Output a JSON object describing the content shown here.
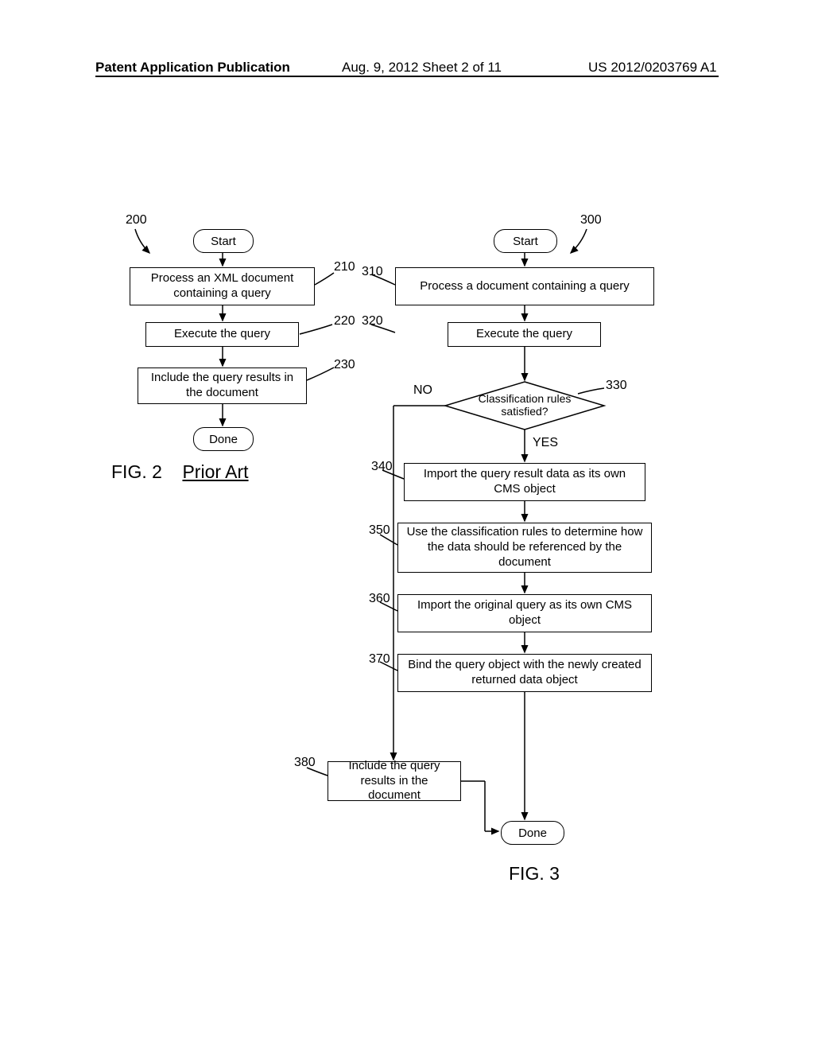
{
  "header": {
    "left": "Patent Application Publication",
    "mid": "Aug. 9, 2012   Sheet 2 of 11",
    "right": "US 2012/0203769 A1"
  },
  "fig2": {
    "ref_main": "200",
    "start": "Start",
    "step210": "Process an XML document containing a query",
    "ref210": "210",
    "step220": "Execute the query",
    "ref220": "220",
    "step230": "Include the query results in the document",
    "ref230": "230",
    "done": "Done",
    "caption_fig": "FIG. 2",
    "caption_sub": "Prior Art"
  },
  "fig3": {
    "ref_main": "300",
    "start": "Start",
    "step310": "Process a document containing a query",
    "ref310": "310",
    "step320": "Execute the query",
    "ref320": "320",
    "decision330": "Classification rules satisfied?",
    "ref330": "330",
    "yes": "YES",
    "no": "NO",
    "step340": "Import the query result data as its own CMS object",
    "ref340": "340",
    "step350": "Use the classification rules to determine how the data should be referenced by the document",
    "ref350": "350",
    "step360": "Import the original query as its own CMS object",
    "ref360": "360",
    "step370": "Bind the query object with the newly created returned data object",
    "ref370": "370",
    "step380": "Include the query results in the document",
    "ref380": "380",
    "done": "Done",
    "caption": "FIG. 3"
  }
}
